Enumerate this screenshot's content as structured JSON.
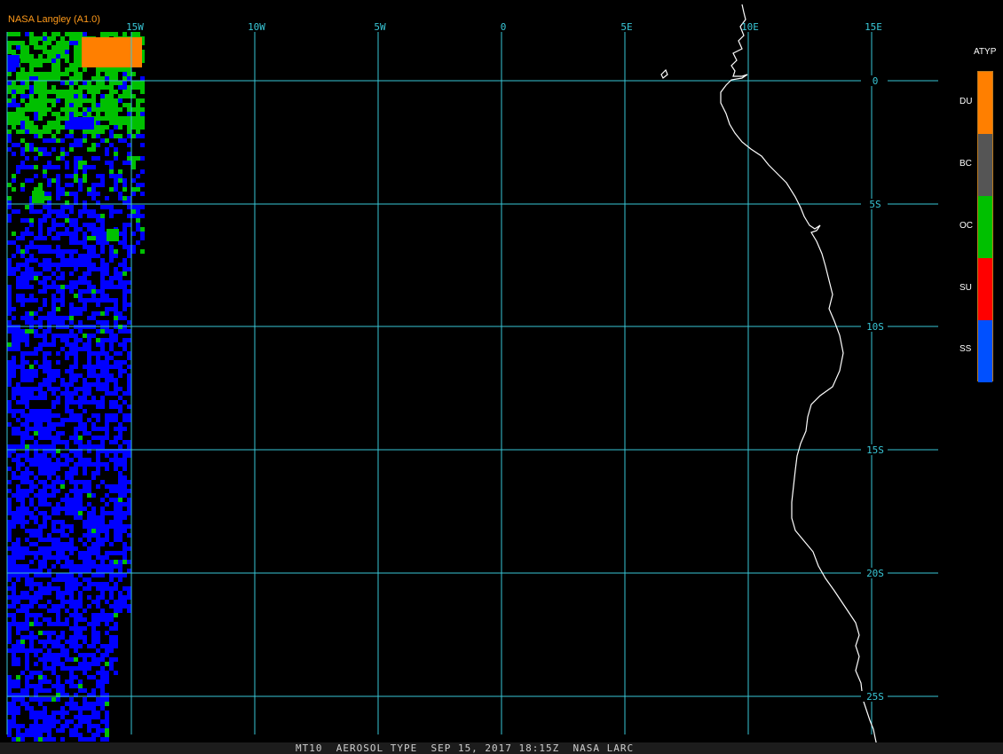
{
  "credit": "NASA Langley (A1.0)",
  "status_bar": "MT10  AEROSOL TYPE  SEP 15, 2017 18:15Z  NASA LARC",
  "legend": {
    "title": "ATYP",
    "items": [
      {
        "label": "DU",
        "color": "#ff7f00"
      },
      {
        "label": "BC",
        "color": "#555555"
      },
      {
        "label": "OC",
        "color": "#00c000"
      },
      {
        "label": "SU",
        "color": "#ff0000"
      },
      {
        "label": "SS",
        "color": "#0050ff"
      }
    ]
  },
  "longitude_labels": [
    "15W",
    "10W",
    "5W",
    "0",
    "5E",
    "10E",
    "15E"
  ],
  "latitude_labels": [
    "0",
    "5S",
    "10S",
    "15S",
    "20S",
    "25S"
  ],
  "colors": {
    "grid": "#39c6d6",
    "coast": "#ffffff",
    "background": "#000000"
  }
}
